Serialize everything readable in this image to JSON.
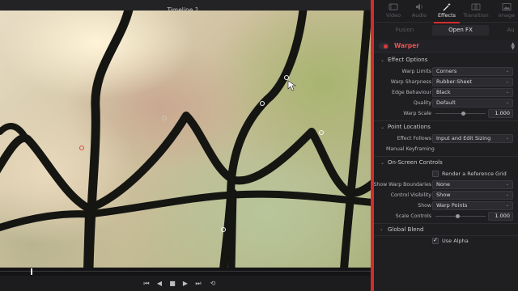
{
  "viewer": {
    "title": "Timeline 1",
    "title_chevron": "⌄",
    "playhead_fraction": 0.083,
    "warp_points_icon": "warp-point-handle",
    "transport": {
      "first_frame_icon": "⏮",
      "prev_icon": "◀",
      "stop_icon": "■",
      "play_icon": "▶",
      "last_frame_icon": "⏭",
      "loop_icon": "⟲"
    }
  },
  "inspector": {
    "tabs": [
      {
        "label": "Video",
        "icon": "video-icon",
        "active": false
      },
      {
        "label": "Audio",
        "icon": "audio-icon",
        "active": false
      },
      {
        "label": "Effects",
        "icon": "effects-wand-icon",
        "active": true
      },
      {
        "label": "Transition",
        "icon": "transition-icon",
        "active": false
      },
      {
        "label": "Image",
        "icon": "image-icon",
        "active": false
      }
    ],
    "sub_tabs": [
      {
        "label": "Fusion",
        "active": false
      },
      {
        "label": "Open FX",
        "active": true
      },
      {
        "label": "Au",
        "active": false
      }
    ],
    "effect": {
      "name": "Warper",
      "enabled": true
    },
    "sections": {
      "effect_options": "Effect Options",
      "point_locations": "Point Locations",
      "on_screen_controls": "On-Screen Controls",
      "global_blend": "Global Blend"
    },
    "params": {
      "warp_limits": {
        "label": "Warp Limits",
        "value": "Corners"
      },
      "warp_sharpness": {
        "label": "Warp Sharpness",
        "value": "Rubber-Sheet"
      },
      "edge_behaviour": {
        "label": "Edge Behaviour",
        "value": "Black"
      },
      "quality": {
        "label": "Quality",
        "value": "Default"
      },
      "warp_scale": {
        "label": "Warp Scale",
        "value": "1.000",
        "fraction": 0.55
      },
      "effect_follows": {
        "label": "Effect Follows",
        "value": "Input and Edit Sizing"
      },
      "manual_keyframing": {
        "label": "Manual Keyframing"
      },
      "render_reference_grid": {
        "label": "Render a Reference Grid",
        "checked": false
      },
      "show_warp_boundaries": {
        "label": "Show Warp Boundaries",
        "value": "None"
      },
      "control_visibility": {
        "label": "Control Visibility",
        "value": "Show"
      },
      "show": {
        "label": "Show",
        "value": "Warp Points"
      },
      "scale_controls": {
        "label": "Scale Controls",
        "value": "1.000",
        "fraction": 0.45
      },
      "use_alpha": {
        "label": "Use Alpha",
        "checked": true
      }
    },
    "dropdown_chevron": "⌄",
    "section_arrow_open": "⌄",
    "section_arrow_closed": "›",
    "colors": {
      "accent": "#d32c2c",
      "effect_name": "#e45656"
    }
  }
}
